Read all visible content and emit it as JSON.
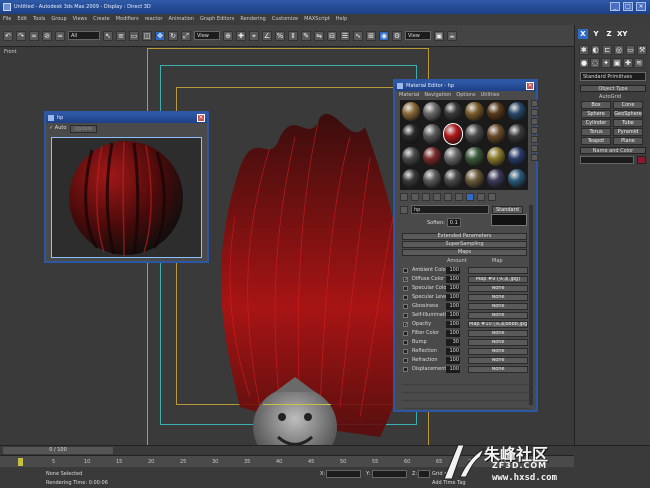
{
  "app": {
    "title": "Untitled - Autodesk 3ds Max 2009 - Display : Direct 3D",
    "window_buttons": [
      "_",
      "□",
      "×"
    ]
  },
  "menu": [
    "File",
    "Edit",
    "Tools",
    "Group",
    "Views",
    "Create",
    "Modifiers",
    "reactor",
    "Animation",
    "Graph Editors",
    "Rendering",
    "Customize",
    "MAXScript",
    "Help"
  ],
  "toolbar": {
    "selection_filter": "All",
    "reference_coord": "View",
    "named_selection": "View"
  },
  "viewport": {
    "label": "Front"
  },
  "command_panel": {
    "axis_labels": [
      "X",
      "Y",
      "Z",
      "XY"
    ],
    "category": "Standard Primitives",
    "object_type_header": "Object Type",
    "autogrid": "AutoGrid",
    "buttons": [
      "Box",
      "Cone",
      "Sphere",
      "GeoSphere",
      "Cylinder",
      "Tube",
      "Torus",
      "Pyramid",
      "Teapot",
      "Plane"
    ],
    "name_color_header": "Name and Color",
    "color": "#8a1a2a"
  },
  "material_preview": {
    "title": "hp",
    "auto_label": "Auto",
    "update_label": "Update"
  },
  "material_editor": {
    "title": "Material Editor - hp",
    "menus": [
      "Material",
      "Navigation",
      "Options",
      "Utilities"
    ],
    "material_name": "hp",
    "material_type": "Standard",
    "soften_label": "Soften:",
    "soften_value": "0.1",
    "sections": [
      "Extended Parameters",
      "SuperSampling",
      "Maps"
    ],
    "maps_header": {
      "amount": "Amount",
      "map": "Map"
    },
    "maps": [
      {
        "name": "Ambient Color",
        "amount": "100",
        "map": "",
        "checked": false
      },
      {
        "name": "Diffuse Color",
        "amount": "100",
        "map": "Map #9 (头发.jpg)",
        "checked": true
      },
      {
        "name": "Specular Color",
        "amount": "100",
        "map": "None",
        "checked": false
      },
      {
        "name": "Specular Level",
        "amount": "100",
        "map": "None",
        "checked": false
      },
      {
        "name": "Glossiness",
        "amount": "100",
        "map": "None",
        "checked": false
      },
      {
        "name": "Self-Illumination",
        "amount": "100",
        "map": "None",
        "checked": false
      },
      {
        "name": "Opacity",
        "amount": "100",
        "map": "Map #10 (头发bbbb.jpg)",
        "checked": true
      },
      {
        "name": "Filter Color",
        "amount": "100",
        "map": "None",
        "checked": false
      },
      {
        "name": "Bump",
        "amount": "30",
        "map": "None",
        "checked": false
      },
      {
        "name": "Reflection",
        "amount": "100",
        "map": "None",
        "checked": false
      },
      {
        "name": "Refraction",
        "amount": "100",
        "map": "None",
        "checked": false
      },
      {
        "name": "Displacement",
        "amount": "100",
        "map": "None",
        "checked": false
      }
    ]
  },
  "timeline": {
    "frame": "0 / 100",
    "ticks": [
      "0",
      "5",
      "10",
      "15",
      "20",
      "25",
      "30",
      "35",
      "40",
      "45",
      "50",
      "55",
      "60",
      "65",
      "70",
      "75",
      "80"
    ]
  },
  "status": {
    "selection": "None Selected",
    "rendering_time_label": "Rendering Time: 0:00:06",
    "x_label": "X:",
    "y_label": "Y:",
    "z_label": "Z:",
    "grid_label": "Grid =",
    "add_time_tag": "Add Time Tag"
  },
  "watermark": {
    "brand": "朱峰社区",
    "site": "ZF3D.COM",
    "url": "www.hxsd.com"
  }
}
